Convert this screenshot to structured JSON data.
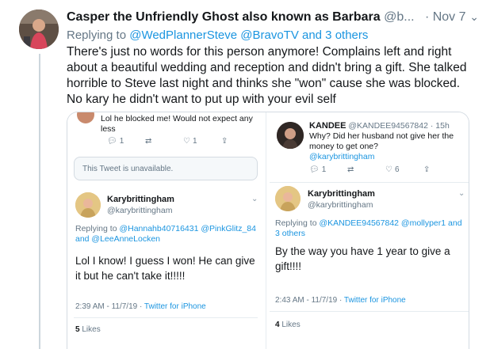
{
  "tweet": {
    "display_name": "Casper the Unfriendly Ghost also known as Barbara",
    "handle": "@b...",
    "separator": "·",
    "date": "Nov 7",
    "replying_prefix": "Replying to",
    "replying_targets": "@WedPlannerSteve @BravoTV and 3 others",
    "text": "There's just no words for this person anymore! Complains left and right about a beautiful wedding and reception and didn't bring a gift. She talked horrible to Steve last night and thinks she \"won\" cause she was blocked. No kary he didn't want to put up with your evil self"
  },
  "screenshot_left": {
    "top_text": "Lol he blocked me! Would not expect any less",
    "top_actions": {
      "replies": "1",
      "retweets": "",
      "likes": "1"
    },
    "unavailable": "This Tweet is unavailable.",
    "author_name": "Karybrittingham",
    "author_handle": "@karybrittingham",
    "replying_prefix": "Replying to",
    "replying_targets": "@Hannahb40716431 @PinkGlitz_84 and @LeeAnneLocken",
    "text": "Lol I know! I guess I won! He can give it but he can't take it!!!!!",
    "timestamp": "2:39 AM - 11/7/19",
    "source": "Twitter for iPhone",
    "likes_count": "5",
    "likes_label": "Likes"
  },
  "screenshot_right": {
    "kandee_name": "KANDEE",
    "kandee_handle": "@KANDEE94567842",
    "kandee_time": "15h",
    "kandee_text": "Why? Did her husband not give her the money to get one?",
    "kandee_mention": "@karybrittingham",
    "kandee_actions": {
      "replies": "1",
      "retweets": "",
      "likes": "6"
    },
    "author_name": "Karybrittingham",
    "author_handle": "@karybrittingham",
    "replying_prefix": "Replying to",
    "replying_targets": "@KANDEE94567842 @mollyper1 and 3 others",
    "text": "By the way you have 1 year to give a gift!!!!",
    "timestamp": "2:43 AM - 11/7/19",
    "source": "Twitter for iPhone",
    "likes_count": "4",
    "likes_label": "Likes"
  },
  "icons": [
    "reply-icon",
    "retweet-icon",
    "like-icon",
    "share-icon",
    "chevron-down-icon"
  ],
  "colors": {
    "link": "#1b95e0",
    "muted": "#657786",
    "text": "#14171a"
  }
}
